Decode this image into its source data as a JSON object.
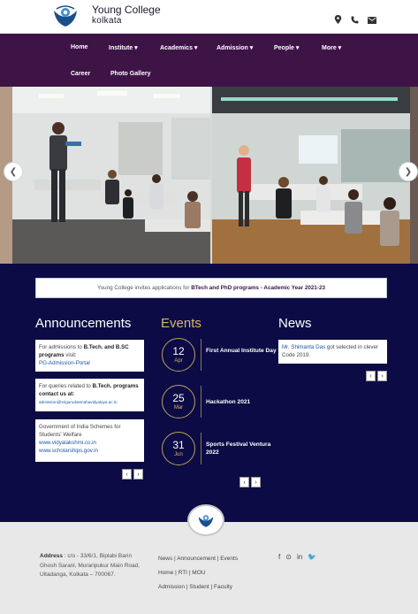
{
  "brand": {
    "name": "Young College",
    "sub": "kolkata"
  },
  "header_icons": [
    "map-pin-icon",
    "phone-icon",
    "envelope-icon"
  ],
  "nav": {
    "home": "Home",
    "institute": "Institute ▾",
    "academics": "Academics ▾",
    "admission": "Admission ▾",
    "people": "People ▾",
    "more": "More ▾",
    "career": "Career",
    "gallery": "Photo Gallery"
  },
  "carousel": {
    "prev": "❮",
    "next": "❯"
  },
  "notice": {
    "prefix": "Young College invites applications for ",
    "highlight": "BTech and PhD programs - Academic Year 2021-23"
  },
  "announcements": {
    "title": "Announcements",
    "items": [
      {
        "line1": "For admissions to ",
        "bold1": "B.Tech. and B.SC programs",
        "line2": " visit:",
        "link": "PG-Admission-Portal"
      },
      {
        "line1": "For queries related to ",
        "bold1": "B.Tech. programs",
        "line2": "contact us at:",
        "link": "admission@srigurudasmahavidyalaya.ac.in"
      },
      {
        "line1": "Government of India Schemes for Students' Welfare",
        "link1": "www.vidyalakshmi.co.in",
        "link2": "www.scholarships.gov.in"
      }
    ]
  },
  "events": {
    "title": "Events",
    "items": [
      {
        "day": "12",
        "month": "Apr",
        "title": "First Annual Institute Day"
      },
      {
        "day": "25",
        "month": "Mar",
        "title": "Hackathon 2021"
      },
      {
        "day": "31",
        "month": "Jun",
        "title": "Sports Festival Ventura 2022"
      }
    ]
  },
  "news": {
    "title": "News",
    "highlight": "Mr. Shimanta Das",
    "text": " got selected in clever Code 2019."
  },
  "pager": {
    "prev": "‹",
    "next": "›"
  },
  "footer": {
    "address_label": "Address",
    "address": " : c/o - 33/6/1, Biplabi Barin Ghosh Sarani, Muraripukur Main Road, Ultadanga, Kolkata – 700067.",
    "links_row1": "News | Announcement | Events",
    "links_row2": "Home | RTI | MOU",
    "links_row3": "Admission | Student | Faculty",
    "social": [
      "f",
      "⊙",
      "in",
      "🐦"
    ]
  },
  "colors": {
    "nav_bg": "#3e1447",
    "dark_bg": "#0c0b45",
    "gold": "#d6b867"
  }
}
